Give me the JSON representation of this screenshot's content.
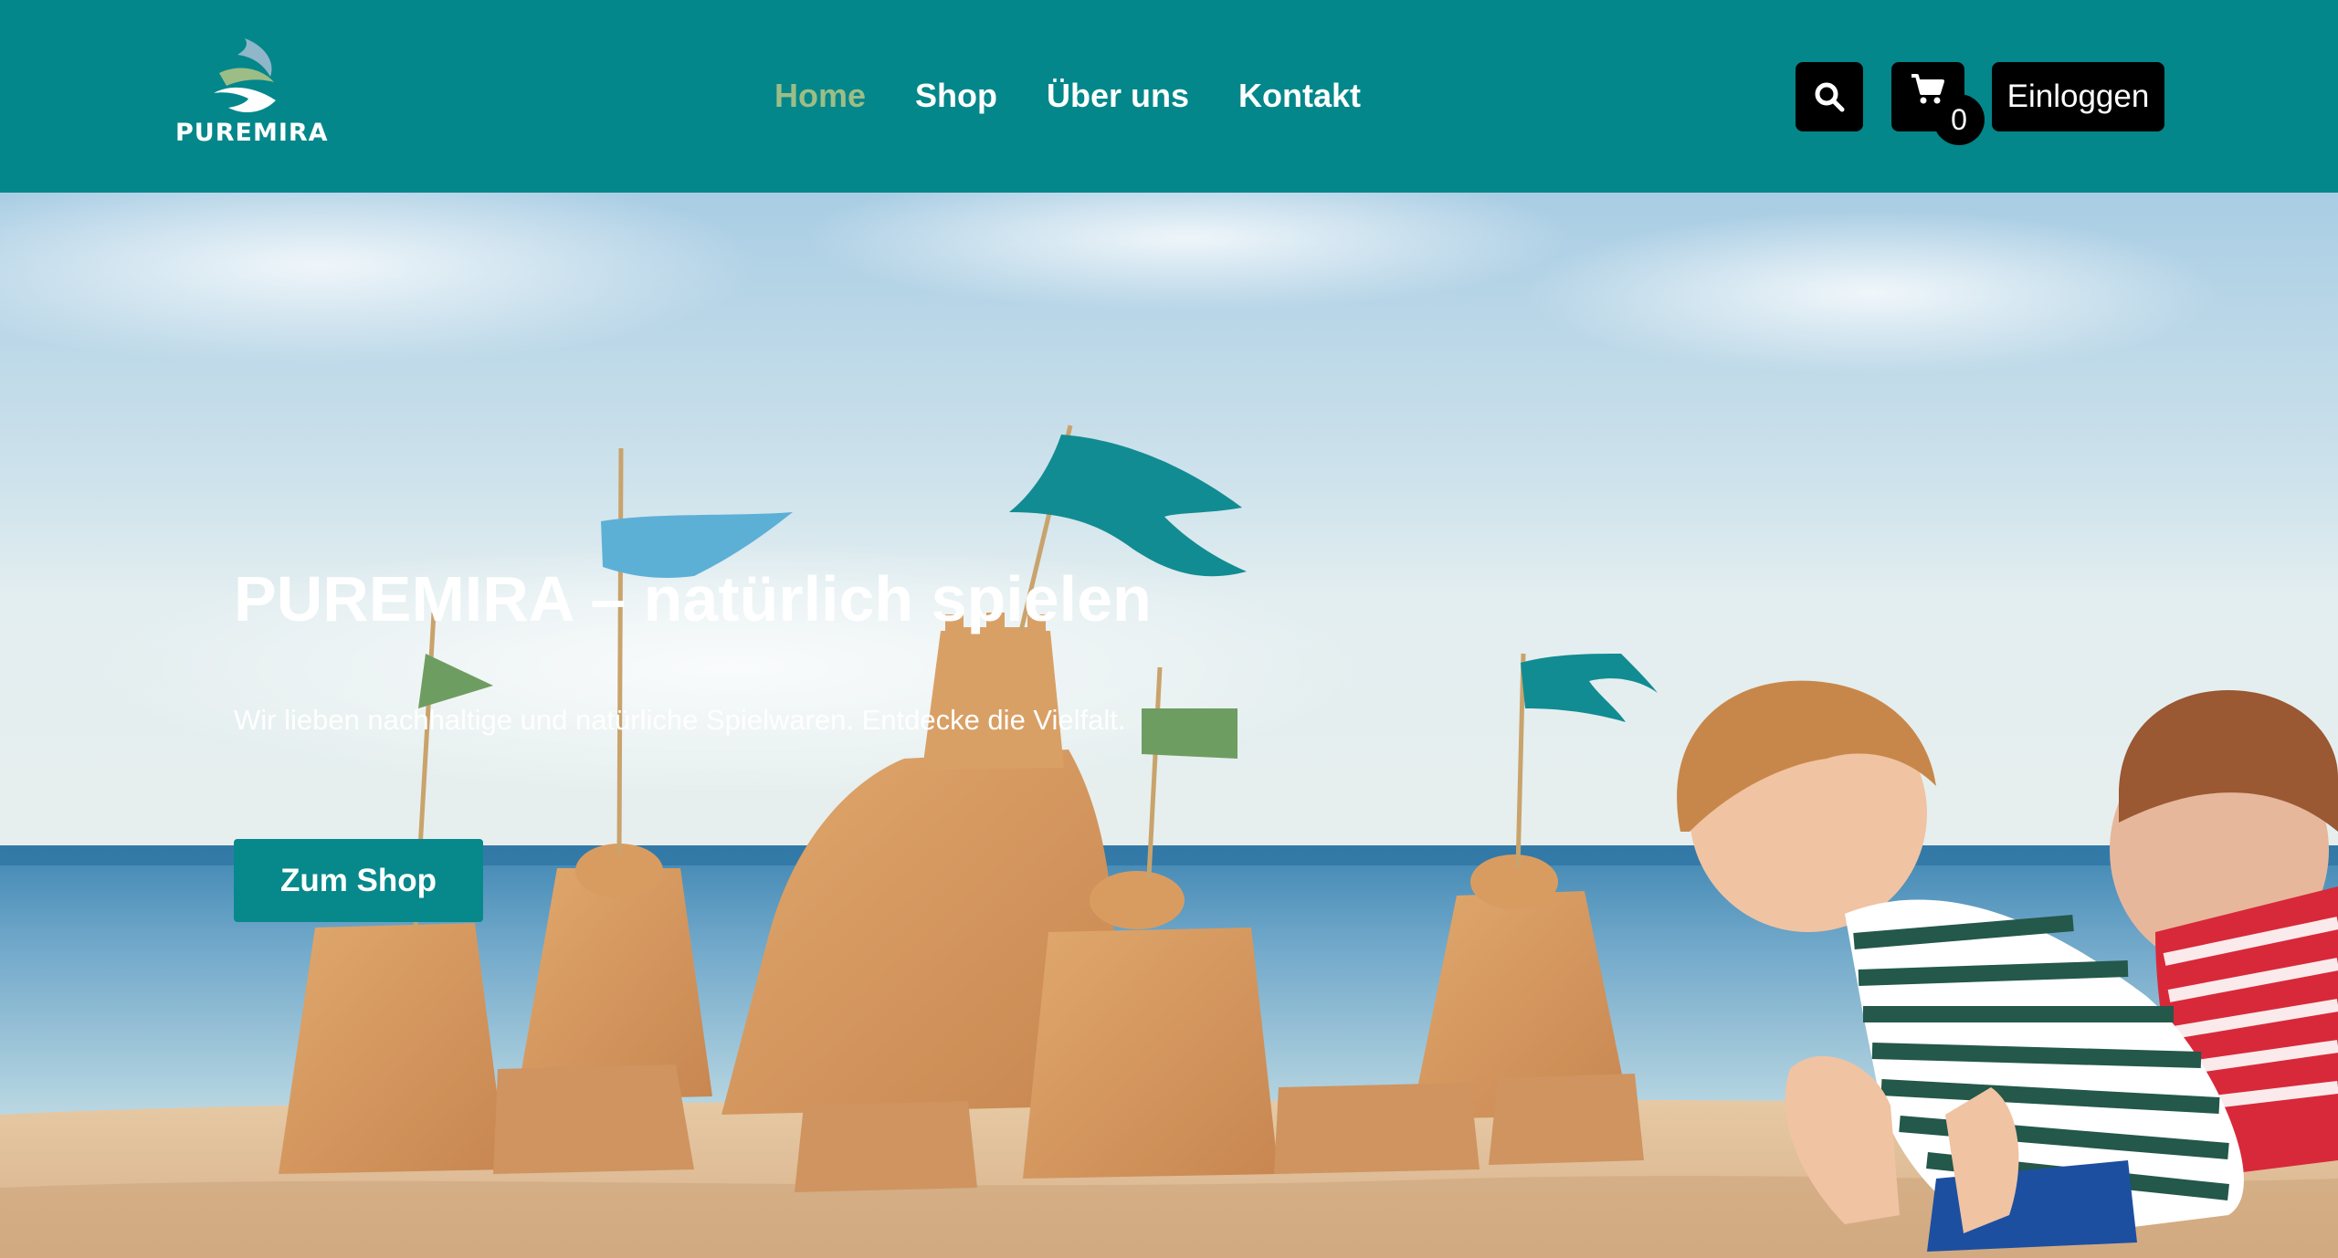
{
  "brand": {
    "name": "PUREMIRA"
  },
  "nav": {
    "items": [
      {
        "label": "Home",
        "active": true
      },
      {
        "label": "Shop",
        "active": false
      },
      {
        "label": "Über uns",
        "active": false
      },
      {
        "label": "Kontakt",
        "active": false
      }
    ]
  },
  "header_actions": {
    "search_icon": "search-icon",
    "cart_icon": "shopping-cart-icon",
    "cart_count": "0",
    "login_label": "Einloggen"
  },
  "hero": {
    "title": "PUREMIRA – natürlich spielen",
    "subtitle": "Wir lieben nachhaltige und natürliche Spielwaren. Entdecke die Vielfalt.",
    "cta_label": "Zum Shop"
  },
  "colors": {
    "header_bg": "#03878a",
    "nav_active": "#9dbd87",
    "cta_bg": "#07898b",
    "button_dark": "#000000"
  }
}
